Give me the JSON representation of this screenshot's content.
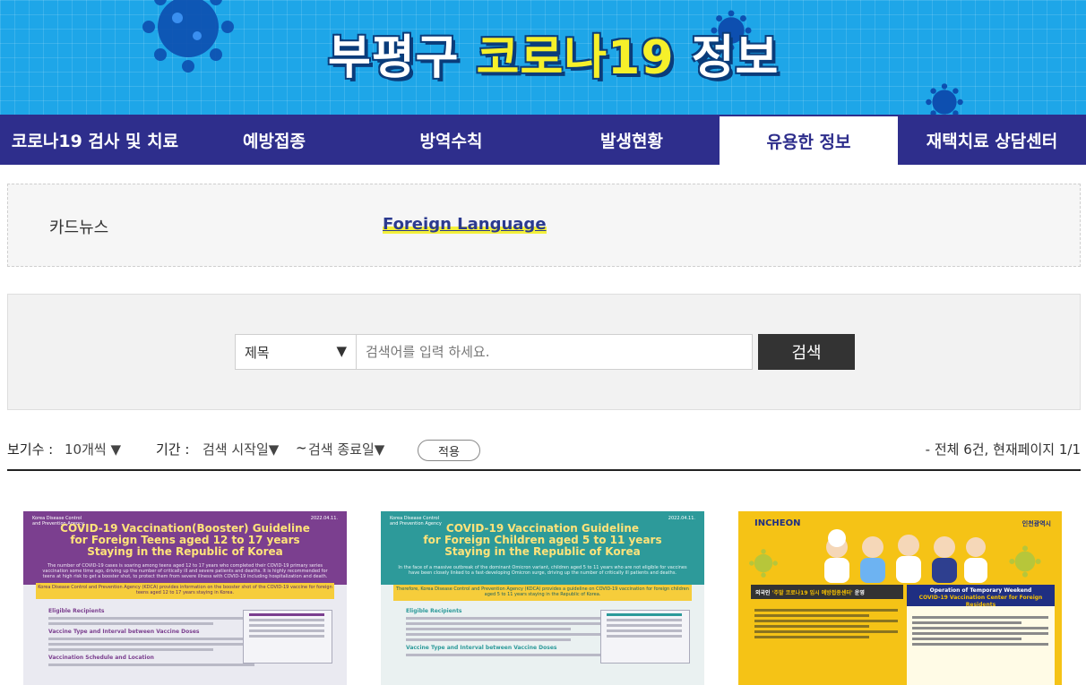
{
  "banner": {
    "title_white_1": "부평구 ",
    "title_yellow": "코로나19",
    "title_white_2": " 정보"
  },
  "nav": {
    "tabs": [
      {
        "label": "코로나19 검사 및 치료",
        "active": false
      },
      {
        "label": "예방접종",
        "active": false
      },
      {
        "label": "방역수칙",
        "active": false
      },
      {
        "label": "발생현황",
        "active": false
      },
      {
        "label": "유용한 정보",
        "active": true
      },
      {
        "label": "재택치료 상담센터",
        "active": false
      }
    ]
  },
  "submenu": {
    "cardnews": "카드뉴스",
    "foreign": "Foreign Language"
  },
  "search": {
    "select_value": "제목",
    "placeholder": "검색어를 입력 하세요.",
    "button": "검색"
  },
  "filters": {
    "view_count_label": "보기수 :",
    "view_count_value": "10개씩",
    "period_label": "기간 :",
    "start_value": "검색 시작일",
    "separator": "~",
    "end_value": "검색 종료일",
    "apply": "적용",
    "total": "- 전체 6건, 현재페이지 1/1"
  },
  "cards": [
    {
      "agency": "Korea Disease Control and Prevention Agency",
      "date": "2022.04.11.",
      "title_line1": "COVID-19 Vaccination(Booster) Guideline",
      "title_line2": "for Foreign Teens aged 12 to 17 years",
      "title_line3": "Staying in the Republic of Korea",
      "intro": "The number of COVID-19 cases is soaring among teens aged 12 to 17 years who completed their COVID-19 primary series vaccination some time ago, driving up the number of critically ill and severe patients and deaths. It is highly recommended for teens at high risk to get a booster shot, to protect them from severe illness with COVID-19 including hospitalization and death.",
      "highlight": "Korea Disease Control and Prevention Agency (KDCA) provides information on the booster shot of the COVID-19 vaccine for foreign teens aged 12 to 17 years staying in Korea.",
      "sec1": "Eligible Recipients",
      "sec2": "Vaccine Type and Interval between Vaccine Doses",
      "sec3": "Vaccination Schedule and Location"
    },
    {
      "agency": "Korea Disease Control and Prevention Agency",
      "date": "2022.04.11.",
      "title_line1": "COVID-19 Vaccination Guideline",
      "title_line2": "for Foreign Children aged 5 to 11 years",
      "title_line3": "Staying in the Republic of Korea",
      "intro": "In the face of a massive outbreak of the dominant Omicron variant, children aged 5 to 11 years who are not eligible for vaccines have been closely linked to a fast-developing Omicron surge, driving up the number of critically ill patients and deaths.",
      "highlight": "Therefore, Korea Disease Control and Prevention Agency (KDCA) provides a guideline on COVID-19 vaccination for foreign children aged 5 to 11 years staying in the Republic of Korea.",
      "sec1": "Eligible Recipients",
      "sec2": "Vaccine Type and Interval between Vaccine Doses"
    },
    {
      "incheon": "INCHEON",
      "city": "인천광역시",
      "ko_title_pre": "외국인 ",
      "ko_title_hl": "'주말 코로나19 임시 예방접종센터'",
      "ko_title_post": " 운영",
      "en_title_1": "Operation of Temporary Weekend",
      "en_title_2": "COVID-19 Vaccination Center for Foreign Residents"
    }
  ],
  "colors": {
    "banner": "#1ea6e8",
    "nav": "#2e2e8c",
    "highlight": "#f3f03a",
    "search_button": "#333333"
  }
}
